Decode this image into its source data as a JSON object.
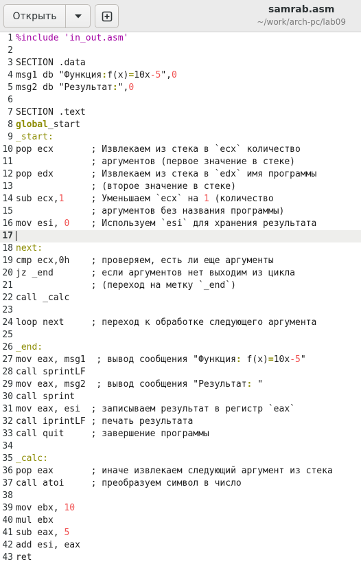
{
  "header": {
    "open_label": "Открыть",
    "menu_icon": "chevron-down-icon",
    "new_icon": "new-document-icon",
    "file_name": "samrab.asm",
    "file_path": "~/work/arch-pc/lab09"
  },
  "editor": {
    "current_line": 17,
    "lines": [
      {
        "n": "1",
        "t": [
          [
            "pre",
            "%include 'in_out.asm'"
          ]
        ]
      },
      {
        "n": "2",
        "t": []
      },
      {
        "n": "3",
        "t": [
          [
            "",
            "SECTION .data"
          ]
        ]
      },
      {
        "n": "4",
        "t": [
          [
            "",
            "msg1 db \"Функция"
          ],
          [
            "kw",
            ":"
          ],
          [
            "",
            ""
          ],
          [
            "",
            "f(x)"
          ],
          [
            "kw",
            "="
          ],
          [
            "",
            "10x"
          ],
          [
            "num",
            "-5"
          ],
          [
            "",
            "\","
          ],
          [
            "num",
            "0"
          ]
        ]
      },
      {
        "n": "5",
        "t": [
          [
            "",
            "msg2 db \"Результат"
          ],
          [
            "kw",
            ":"
          ],
          [
            "",
            ""
          ],
          [
            "",
            "\","
          ],
          [
            "num",
            "0"
          ]
        ]
      },
      {
        "n": "6",
        "t": []
      },
      {
        "n": "7",
        "t": [
          [
            "",
            "SECTION .text"
          ]
        ]
      },
      {
        "n": "8",
        "t": [
          [
            "kw",
            "global"
          ],
          [
            "",
            ""
          ],
          [
            "",
            "_start"
          ]
        ]
      },
      {
        "n": "9",
        "t": [
          [
            "lbl",
            "_start:"
          ]
        ]
      },
      {
        "n": "10",
        "t": [
          [
            "",
            "pop ecx       ; Извлекаем из стека в `ecx` количество"
          ]
        ]
      },
      {
        "n": "11",
        "t": [
          [
            "",
            "              ; аргументов (первое значение в стеке)"
          ]
        ]
      },
      {
        "n": "12",
        "t": [
          [
            "",
            "pop edx       ; Извлекаем из стека в `edx` имя программы"
          ]
        ]
      },
      {
        "n": "13",
        "t": [
          [
            "",
            "              ; (второе значение в стеке)"
          ]
        ]
      },
      {
        "n": "14",
        "t": [
          [
            "",
            "sub ecx,"
          ],
          [
            "num",
            "1"
          ],
          [
            "",
            "     ; Уменьшаем `ecx` на "
          ],
          [
            "num",
            "1"
          ],
          [
            "",
            " (количество"
          ]
        ]
      },
      {
        "n": "15",
        "t": [
          [
            "",
            "              ; аргументов без названия программы)"
          ]
        ]
      },
      {
        "n": "16",
        "t": [
          [
            "",
            "mov esi, "
          ],
          [
            "num",
            "0"
          ],
          [
            "",
            "    ; Используем `esi` для хранения результата"
          ]
        ]
      },
      {
        "n": "17",
        "t": []
      },
      {
        "n": "18",
        "t": [
          [
            "lbl",
            "next:"
          ]
        ]
      },
      {
        "n": "19",
        "t": [
          [
            "",
            "cmp ecx,0h    ; проверяем, есть ли еще аргументы"
          ]
        ]
      },
      {
        "n": "20",
        "t": [
          [
            "",
            "jz _end       ; если аргументов нет выходим из цикла"
          ]
        ]
      },
      {
        "n": "21",
        "t": [
          [
            "",
            "              ; (переход на метку `_end`)"
          ]
        ]
      },
      {
        "n": "22",
        "t": [
          [
            "",
            "call _calc"
          ]
        ]
      },
      {
        "n": "23",
        "t": []
      },
      {
        "n": "24",
        "t": [
          [
            "",
            "loop next     ; переход к обработке следующего аргумента"
          ]
        ]
      },
      {
        "n": "25",
        "t": []
      },
      {
        "n": "26",
        "t": [
          [
            "lbl",
            "_end:"
          ]
        ]
      },
      {
        "n": "27",
        "t": [
          [
            "",
            "mov eax, msg1  ; вывод сообщения \"Функция"
          ],
          [
            "kw",
            ":"
          ],
          [
            "",
            " f(x)"
          ],
          [
            "kw",
            "="
          ],
          [
            "",
            "10x"
          ],
          [
            "num",
            "-5"
          ],
          [
            "",
            "\""
          ]
        ]
      },
      {
        "n": "28",
        "t": [
          [
            "",
            "call sprintLF"
          ]
        ]
      },
      {
        "n": "29",
        "t": [
          [
            "",
            "mov eax, msg2  ; вывод сообщения \"Результат"
          ],
          [
            "kw",
            ":"
          ],
          [
            "",
            " \""
          ]
        ]
      },
      {
        "n": "30",
        "t": [
          [
            "",
            "call sprint"
          ]
        ]
      },
      {
        "n": "31",
        "t": [
          [
            "",
            "mov eax, esi  ; записываем результат в регистр `eax`"
          ]
        ]
      },
      {
        "n": "32",
        "t": [
          [
            "",
            "call iprintLF ; печать результата"
          ]
        ]
      },
      {
        "n": "33",
        "t": [
          [
            "",
            "call quit     ; завершение программы"
          ]
        ]
      },
      {
        "n": "34",
        "t": []
      },
      {
        "n": "35",
        "t": [
          [
            "lbl",
            "_calc:"
          ]
        ]
      },
      {
        "n": "36",
        "t": [
          [
            "",
            "pop eax       ; иначе извлекаем следующий аргумент из стека"
          ]
        ]
      },
      {
        "n": "37",
        "t": [
          [
            "",
            "call atoi     ; преобразуем символ в число"
          ]
        ]
      },
      {
        "n": "38",
        "t": []
      },
      {
        "n": "39",
        "t": [
          [
            "",
            "mov ebx, "
          ],
          [
            "num",
            "10"
          ]
        ]
      },
      {
        "n": "40",
        "t": [
          [
            "",
            "mul ebx"
          ]
        ]
      },
      {
        "n": "41",
        "t": [
          [
            "",
            "sub eax, "
          ],
          [
            "num",
            "5"
          ]
        ]
      },
      {
        "n": "42",
        "t": [
          [
            "",
            "add esi, eax"
          ]
        ]
      },
      {
        "n": "43",
        "t": [
          [
            "",
            "ret"
          ]
        ]
      }
    ]
  }
}
